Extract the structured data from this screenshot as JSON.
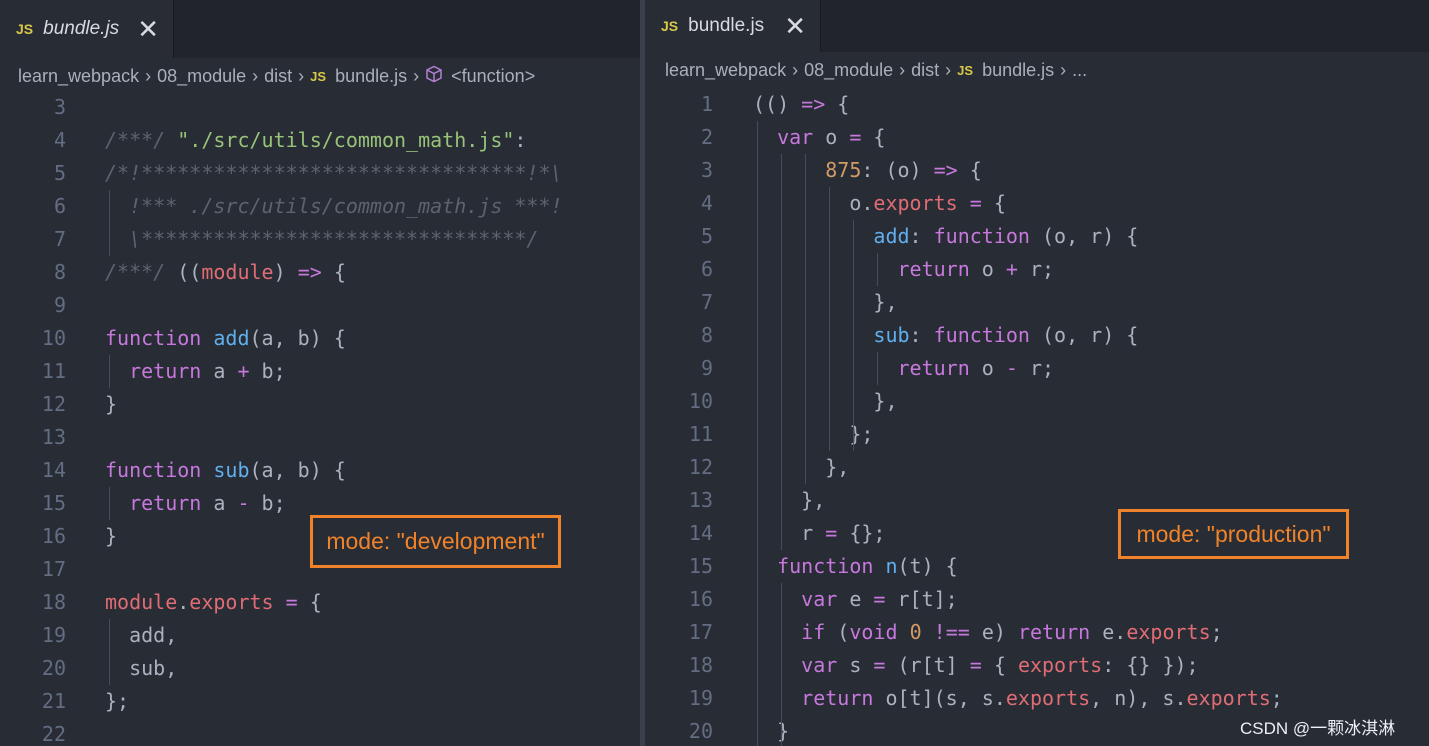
{
  "left": {
    "tab": {
      "badge": "JS",
      "title": "bundle.js",
      "close": "✕"
    },
    "breadcrumb": {
      "seg1": "learn_webpack",
      "seg2": "08_module",
      "seg3": "dist",
      "badge": "JS",
      "file": "bundle.js",
      "symbol": "<function>"
    },
    "lines": [
      {
        "n": "3",
        "t": ""
      },
      {
        "n": "4",
        "t": "/***/ \"./src/utils/common_math.js\":"
      },
      {
        "n": "5",
        "t": "/*!********************************!*\\"
      },
      {
        "n": "6",
        "t": "  !*** ./src/utils/common_math.js ***!"
      },
      {
        "n": "7",
        "t": "  \\********************************/"
      },
      {
        "n": "8",
        "t": "/***/ ((module) => {"
      },
      {
        "n": "9",
        "t": ""
      },
      {
        "n": "10",
        "t": "function add(a, b) {"
      },
      {
        "n": "11",
        "t": "  return a + b;"
      },
      {
        "n": "12",
        "t": "}"
      },
      {
        "n": "13",
        "t": ""
      },
      {
        "n": "14",
        "t": "function sub(a, b) {"
      },
      {
        "n": "15",
        "t": "  return a - b;"
      },
      {
        "n": "16",
        "t": "}"
      },
      {
        "n": "17",
        "t": ""
      },
      {
        "n": "18",
        "t": "module.exports = {"
      },
      {
        "n": "19",
        "t": "  add,"
      },
      {
        "n": "20",
        "t": "  sub,"
      },
      {
        "n": "21",
        "t": "};"
      },
      {
        "n": "22",
        "t": ""
      }
    ]
  },
  "right": {
    "tab": {
      "badge": "JS",
      "title": "bundle.js",
      "close": "✕"
    },
    "breadcrumb": {
      "seg1": "learn_webpack",
      "seg2": "08_module",
      "seg3": "dist",
      "badge": "JS",
      "file": "bundle.js",
      "symbol": "..."
    },
    "lines": [
      {
        "n": "1",
        "t": "(() => {"
      },
      {
        "n": "2",
        "t": "  var o = {"
      },
      {
        "n": "3",
        "t": "      875: (o) => {"
      },
      {
        "n": "4",
        "t": "        o.exports = {"
      },
      {
        "n": "5",
        "t": "          add: function (o, r) {"
      },
      {
        "n": "6",
        "t": "            return o + r;"
      },
      {
        "n": "7",
        "t": "          },"
      },
      {
        "n": "8",
        "t": "          sub: function (o, r) {"
      },
      {
        "n": "9",
        "t": "            return o - r;"
      },
      {
        "n": "10",
        "t": "          },"
      },
      {
        "n": "11",
        "t": "        };"
      },
      {
        "n": "12",
        "t": "      },"
      },
      {
        "n": "13",
        "t": "    },"
      },
      {
        "n": "14",
        "t": "    r = {};"
      },
      {
        "n": "15",
        "t": "  function n(t) {"
      },
      {
        "n": "16",
        "t": "    var e = r[t];"
      },
      {
        "n": "17",
        "t": "    if (void 0 !== e) return e.exports;"
      },
      {
        "n": "18",
        "t": "    var s = (r[t] = { exports: {} });"
      },
      {
        "n": "19",
        "t": "    return o[t](s, s.exports, n), s.exports;"
      },
      {
        "n": "20",
        "t": "  }"
      }
    ]
  },
  "annotations": {
    "dev": "mode: \"development\"",
    "prod": "mode: \"production\""
  },
  "watermark": "CSDN @一颗冰淇淋",
  "colors": {
    "annotation": "#f0832a",
    "editor_bg": "#282c34",
    "js_badge": "#d7c84a"
  }
}
